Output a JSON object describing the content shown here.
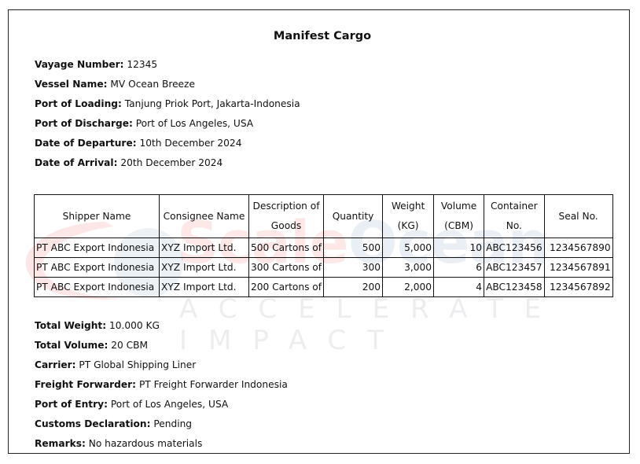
{
  "document": {
    "title": "Manifest Cargo",
    "watermark": {
      "brand_part1": "Scale",
      "brand_part2": "Ocean",
      "tagline": "ACCELERATE IMPACT"
    },
    "header_fields": [
      {
        "label": "Vayage Number:",
        "value": "12345"
      },
      {
        "label": "Vessel Name:",
        "value": "MV Ocean Breeze"
      },
      {
        "label": "Port of Loading:",
        "value": "Tanjung Priok Port, Jakarta-Indonesia"
      },
      {
        "label": "Port of Discharge:",
        "value": "Port of Los Angeles, USA"
      },
      {
        "label": "Date of Departure:",
        "value": "10th December 2024"
      },
      {
        "label": "Date of Arrival:",
        "value": "20th December 2024"
      }
    ],
    "table": {
      "columns": [
        "Shipper Name",
        "Consignee Name",
        "Description of Goods",
        "Quantity",
        "Weight (KG)",
        "Volume (CBM)",
        "Container No.",
        "Seal No."
      ],
      "rows": [
        [
          "PT ABC Export Indonesia",
          "XYZ Import Ltd.",
          "500 Cartons of",
          "500",
          "5,000",
          "10",
          "ABC123456",
          "1234567890"
        ],
        [
          "PT ABC Export Indonesia",
          "XYZ Import Ltd.",
          "300 Cartons of",
          "300",
          "3,000",
          "6",
          "ABC123457",
          "1234567891"
        ],
        [
          "PT ABC Export Indonesia",
          "XYZ Import Ltd.",
          "200 Cartons of",
          "200",
          "2,000",
          "4",
          "ABC123458",
          "1234567892"
        ]
      ]
    },
    "footer_fields": [
      {
        "label": "Total Weight:",
        "value": "10.000 KG"
      },
      {
        "label": "Total Volume:",
        "value": "20 CBM"
      },
      {
        "label": "Carrier:",
        "value": "PT Global Shipping Liner"
      },
      {
        "label": "Freight Forwarder:",
        "value": "PT Freight Forwarder Indonesia"
      },
      {
        "label": "Port of Entry:",
        "value": "Port of Los Angeles, USA"
      },
      {
        "label": "Customs Declaration:",
        "value": "Pending"
      },
      {
        "label": "Remarks:",
        "value": "No hazardous materials"
      }
    ]
  }
}
